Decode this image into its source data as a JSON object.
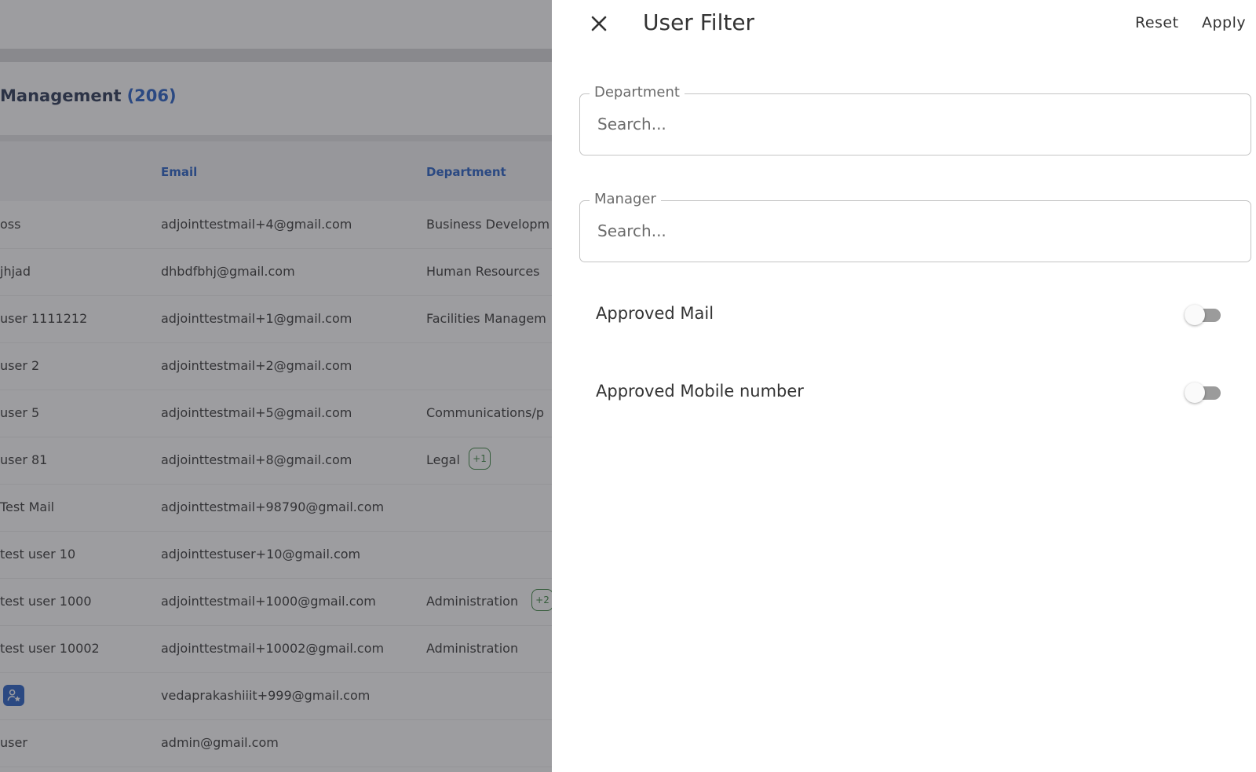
{
  "background": {
    "title": "Management",
    "count": "(206)",
    "columns": {
      "email": "Email",
      "department": "Department"
    },
    "rows": [
      {
        "name": "oss",
        "email": "adjointtestmail+4@gmail.com",
        "department": "Business Developm",
        "badge": ""
      },
      {
        "name": "jhjad",
        "email": "dhbdfbhj@gmail.com",
        "department": "Human Resources",
        "badge": ""
      },
      {
        "name": "user 1111212",
        "email": "adjointtestmail+1@gmail.com",
        "department": "Facilities Managem",
        "badge": ""
      },
      {
        "name": "user 2",
        "email": "adjointtestmail+2@gmail.com",
        "department": "",
        "badge": ""
      },
      {
        "name": "user 5",
        "email": "adjointtestmail+5@gmail.com",
        "department": "Communications/p",
        "badge": ""
      },
      {
        "name": "user 81",
        "email": "adjointtestmail+8@gmail.com",
        "department": "Legal",
        "badge": "+1"
      },
      {
        "name": "Test Mail",
        "email": "adjointtestmail+98790@gmail.com",
        "department": "",
        "badge": ""
      },
      {
        "name": "test user 10",
        "email": "adjointtestuser+10@gmail.com",
        "department": "",
        "badge": ""
      },
      {
        "name": "test user 1000",
        "email": "adjointtestmail+1000@gmail.com",
        "department": "Administration",
        "badge": "+2"
      },
      {
        "name": "test user 10002",
        "email": "adjointtestmail+10002@gmail.com",
        "department": "Administration",
        "badge": ""
      },
      {
        "name": "",
        "email": "vedaprakashiiit+999@gmail.com",
        "department": "",
        "badge": "",
        "avatar_icon": "user-star-icon"
      },
      {
        "name": "user",
        "email": "admin@gmail.com",
        "department": "",
        "badge": ""
      }
    ]
  },
  "drawer": {
    "title": "User Filter",
    "close_icon": "close-icon",
    "reset_label": "Reset",
    "apply_label": "Apply",
    "department": {
      "label": "Department",
      "placeholder": "Search...",
      "value": ""
    },
    "manager": {
      "label": "Manager",
      "placeholder": "Search...",
      "value": ""
    },
    "toggles": [
      {
        "label": "Approved Mail",
        "checked": false
      },
      {
        "label": "Approved Mobile number",
        "checked": false
      }
    ]
  },
  "colors": {
    "accent": "#1a57c2",
    "chip": "#2f7d34",
    "overlay": "rgba(60,60,66,0.5)"
  }
}
